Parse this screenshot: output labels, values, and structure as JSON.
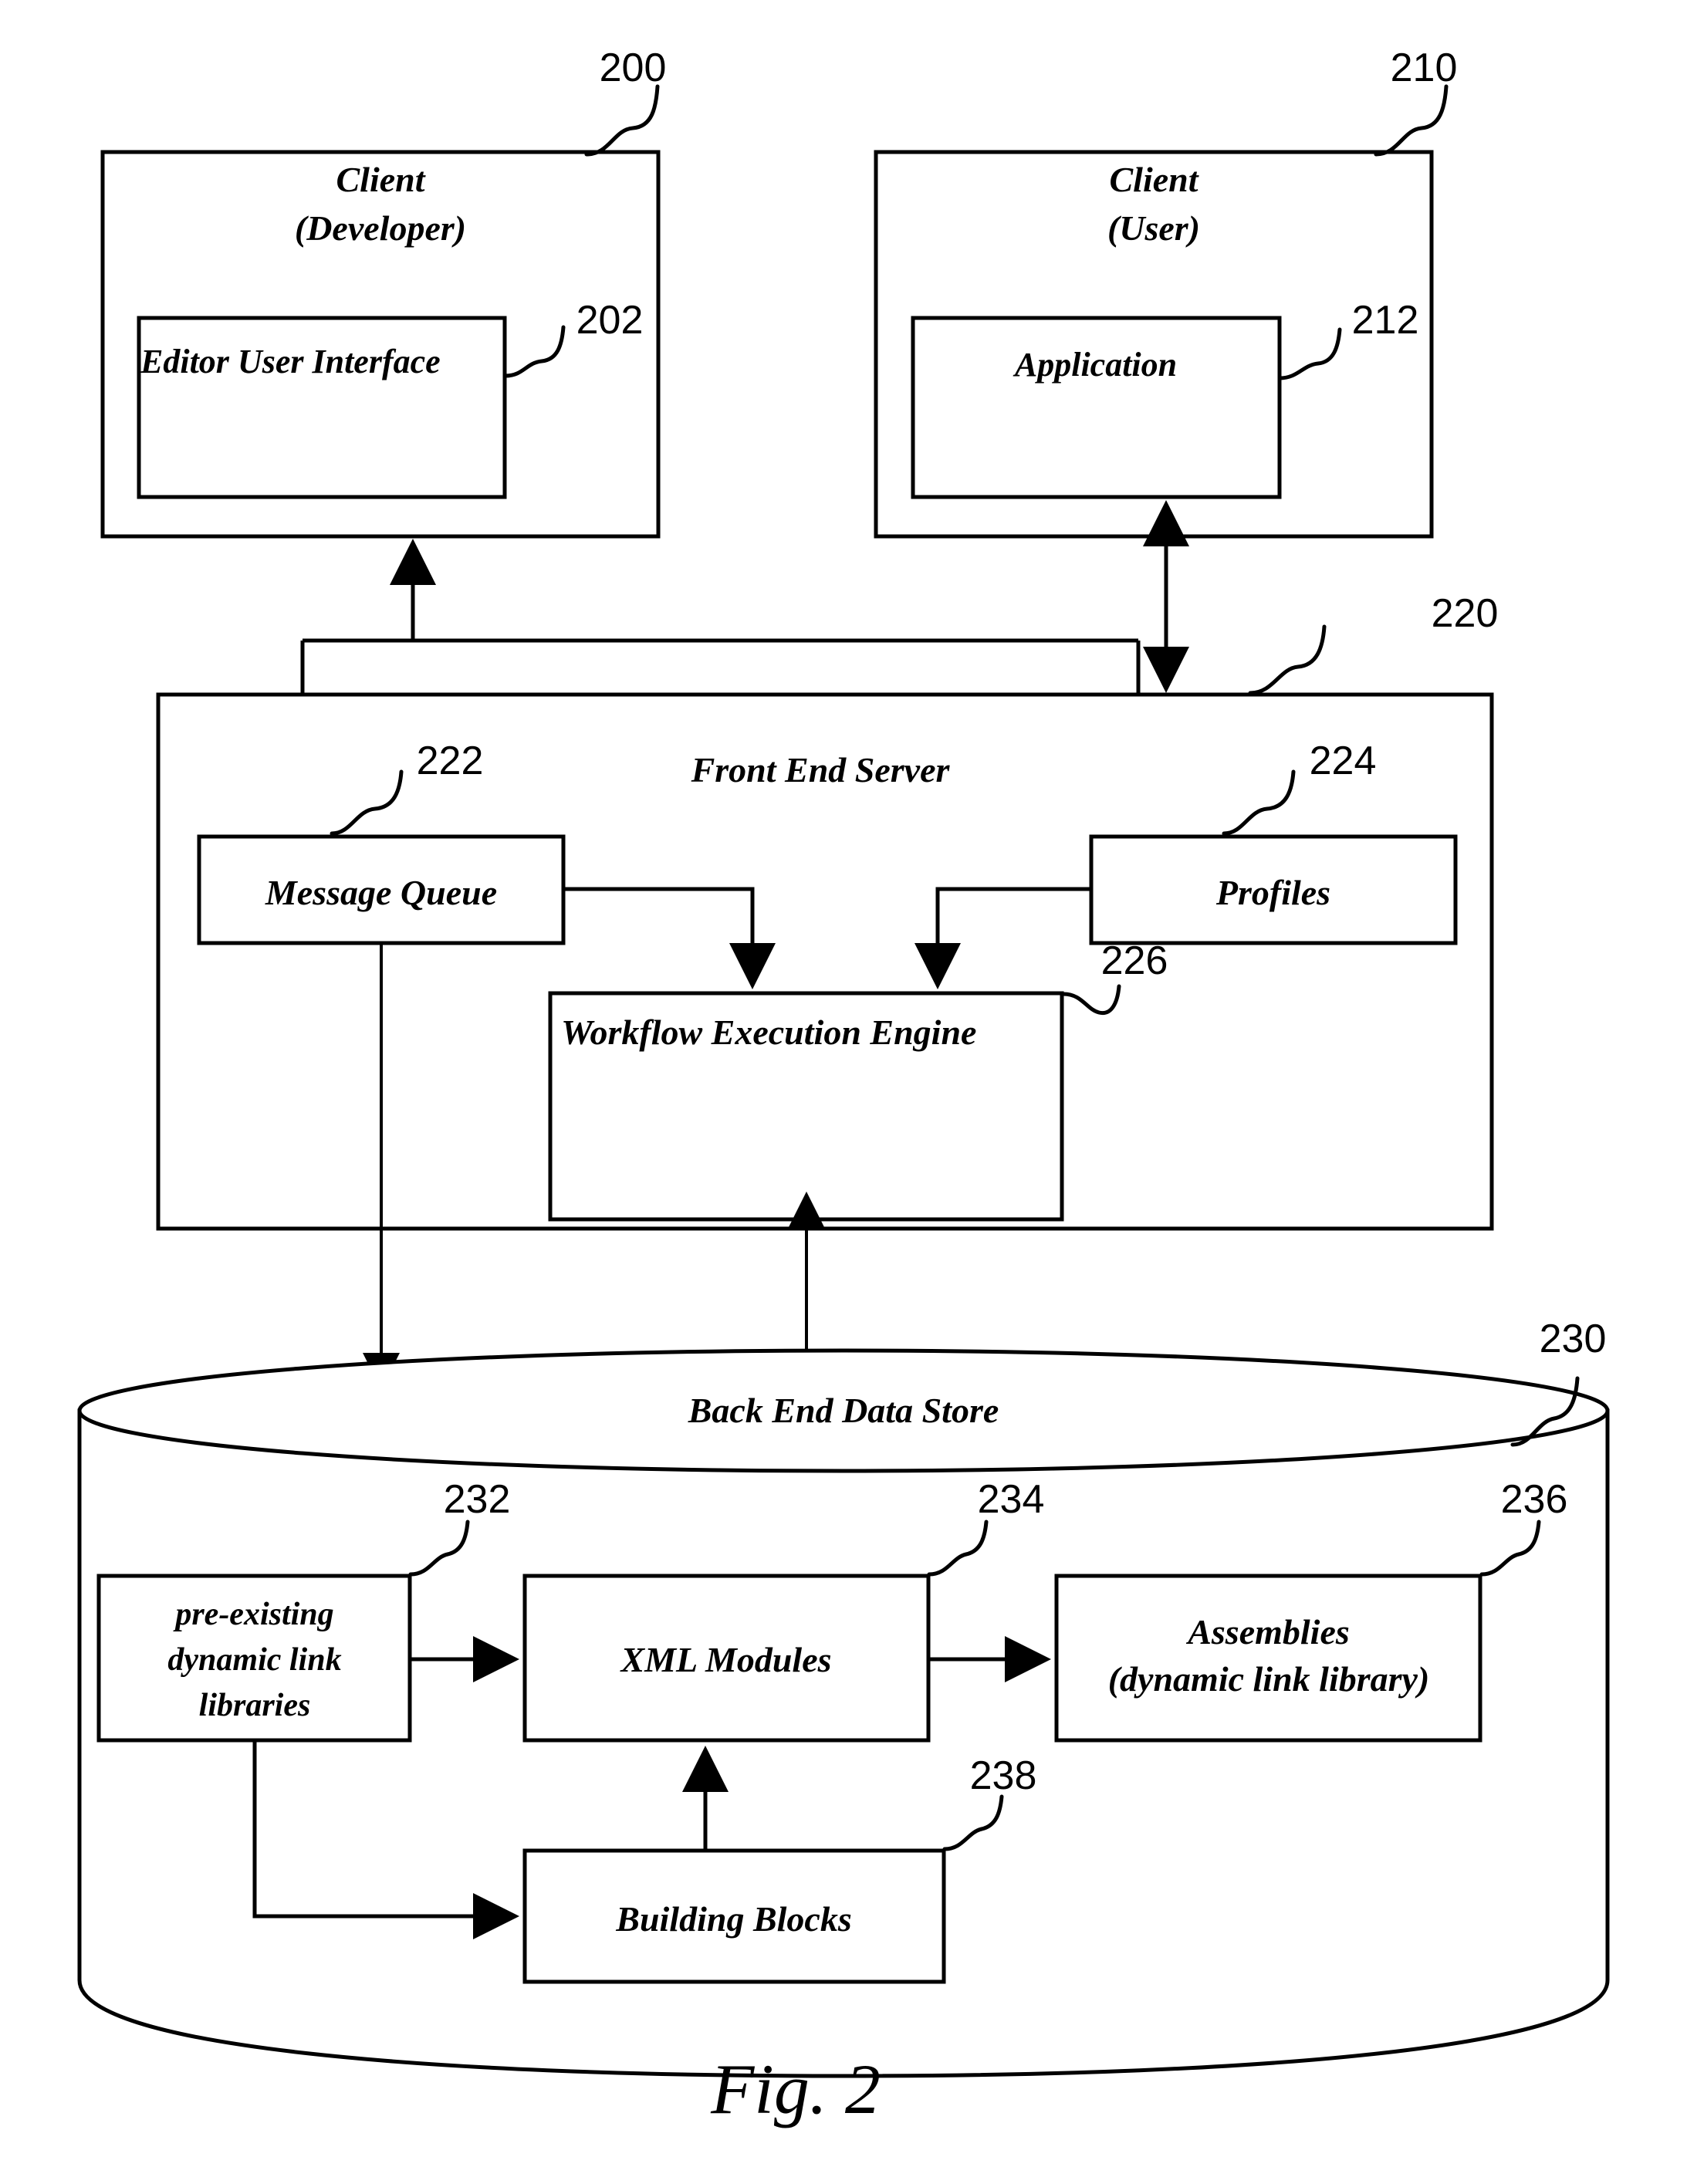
{
  "figure": {
    "caption": "Fig. 2",
    "type": "patent-block-diagram"
  },
  "nodes": {
    "client_developer": {
      "ref": "200",
      "title_line1": "Client",
      "title_line2": "(Developer)"
    },
    "editor_ui": {
      "ref": "202",
      "label": "Editor User Interface"
    },
    "client_user": {
      "ref": "210",
      "title_line1": "Client",
      "title_line2": "(User)"
    },
    "application": {
      "ref": "212",
      "label": "Application"
    },
    "front_end_server": {
      "ref": "220",
      "label": "Front End Server"
    },
    "message_queue": {
      "ref": "222",
      "label": "Message Queue"
    },
    "profiles": {
      "ref": "224",
      "label": "Profiles"
    },
    "workflow_execution_engine": {
      "ref": "226",
      "label": "Workflow Execution Engine"
    },
    "back_end_data_store": {
      "ref": "230",
      "label": "Back End Data Store"
    },
    "pre_existing_dlls": {
      "ref": "232",
      "label_line1": "pre-existing",
      "label_line2": "dynamic link",
      "label_line3": "libraries"
    },
    "xml_modules": {
      "ref": "234",
      "label": "XML Modules"
    },
    "assemblies": {
      "ref": "236",
      "label_line1": "Assemblies",
      "label_line2": "(dynamic link library)"
    },
    "building_blocks": {
      "ref": "238",
      "label": "Building Blocks"
    }
  },
  "colors": {
    "ink": "#000000",
    "paper": "#ffffff"
  }
}
